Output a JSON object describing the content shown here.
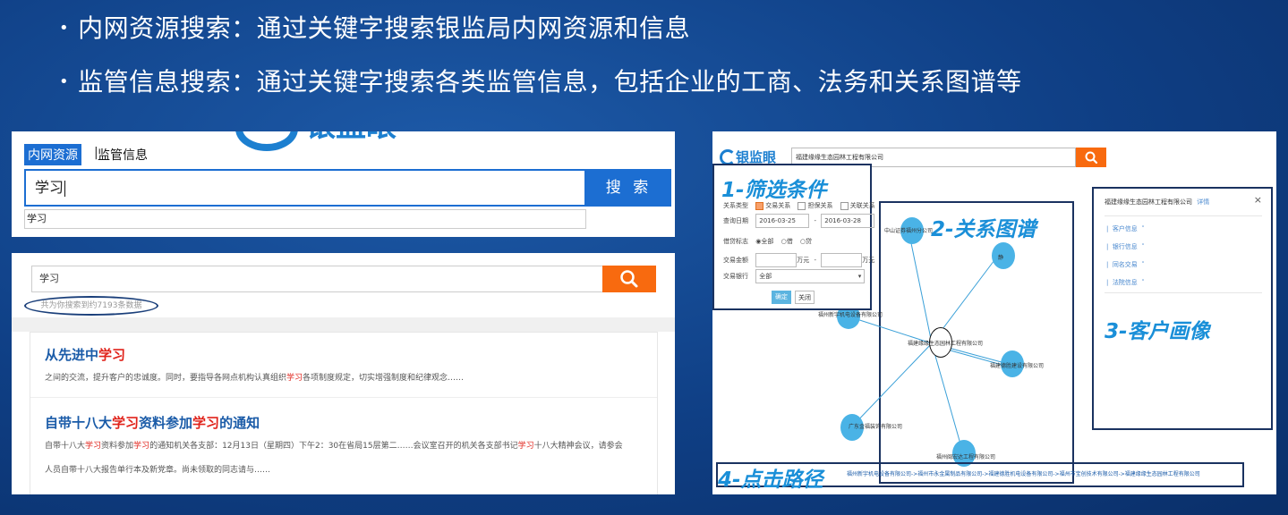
{
  "bullets": [
    "内网资源搜索：通过关键字搜索银监局内网资源和信息",
    "监管信息搜索：通过关键字搜索各类监管信息，包括企业的工商、法务和关系图谱等"
  ],
  "panel1": {
    "logo": "银监眼",
    "tabs": [
      "内网资源",
      "监管信息"
    ],
    "tab_sep": "|",
    "search_value": "学习",
    "search_button": "搜 索",
    "suggestion": "学习"
  },
  "panel2": {
    "search_value": "学习",
    "count_text": "共为你搜索到约7193条数据",
    "results": [
      {
        "title_a": "从先进中",
        "title_hl": "学习",
        "title_b": "",
        "desc_a": "之间的交流，提升客户的忠诚度。同时，要指导各网点机构认真组织",
        "desc_hl": "学习",
        "desc_b": "各项制度规定，切实增强制度和纪律观念……"
      },
      {
        "title_a": "自带十八大",
        "title_hl": "学习",
        "title_b": "资料参加",
        "title_hl2": "学习",
        "title_c": "的通知",
        "desc_a": "自带十八大",
        "desc_hl": "学习",
        "desc_b": "资料参加",
        "desc_hl2": "学习",
        "desc_c": "的通知机关各支部：12月13日（星期四）下午2：30在省局15层第二……会议室召开的机关各支部书记",
        "desc_hl3": "学习",
        "desc_d": "十八大精神会议，请参会",
        "desc_line2": "人员自带十八大报告单行本及新党章。尚未领取的同志请与……"
      }
    ]
  },
  "panel3": {
    "logo": "银监眼",
    "search_value": "福建缘缘生态园林工程有限公司",
    "labels": {
      "filter": "1-筛选条件",
      "graph": "2-关系图谱",
      "customer": "3-客户画像",
      "path": "4-点击路径"
    },
    "filter": {
      "rel_type_label": "关系类型",
      "rel_types": [
        "交易关系",
        "担保关系",
        "关联关系"
      ],
      "date_label": "查询日期",
      "date_from": "2016-03-25",
      "date_sep": "-",
      "date_to": "2016-03-28",
      "mark_label": "借贷标志",
      "marks": [
        "全部",
        "借",
        "贷"
      ],
      "amount_label": "交易金额",
      "amount_unit": "万元",
      "bank_label": "交易银行",
      "bank_value": "全部",
      "confirm": "确定",
      "close": "关闭"
    },
    "graph_nodes": [
      "中山证券福州分公司",
      "静",
      "福州新宇机电设备有限公司",
      "福建缘缘生态园林工程有限公司",
      "福建德胜建设有限公司",
      "广东金福装饰有限公司",
      "福州闽宏达工程有限公司"
    ],
    "customer": {
      "title": "福建缘缘生态园林工程有限公司",
      "detail": "详情",
      "close": "×",
      "items": [
        "客户信息",
        "银行信息",
        "同名交易",
        "法院信息"
      ]
    },
    "path_text": "福州新宇机电设备有限公司->福州市永金属制品有限公司->福建德胜机电设备有限公司->福州市宝创技术有限公司->福建缘缘生态园林工程有限公司"
  },
  "colors": {
    "accent": "#1c6ed2",
    "orange": "#f86a0f",
    "highlight": "#e0221a",
    "label_blue": "#1a8fd8"
  }
}
